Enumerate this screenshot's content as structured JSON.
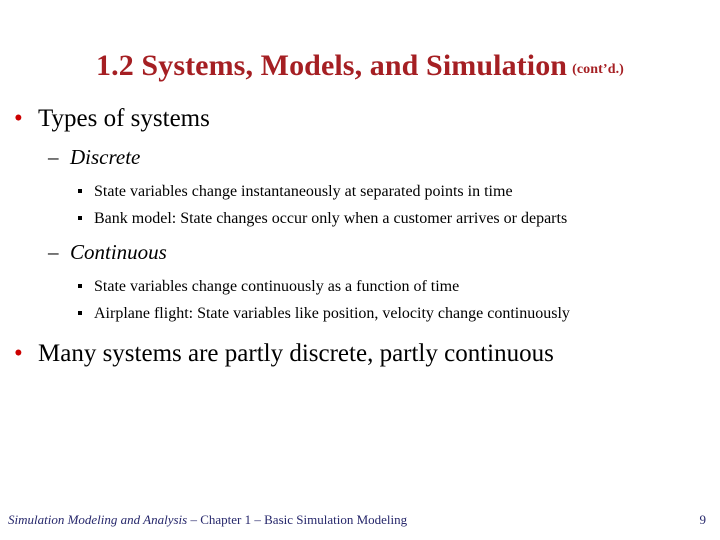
{
  "slide": {
    "title": {
      "main": "1.2  Systems, Models, and Simulation",
      "suffix": "(cont’d.)",
      "color": "#A51F23"
    },
    "bullet_colors": {
      "level1_marker": "#CC0000",
      "level2_marker": "#000000",
      "level3_marker": "#000000",
      "text": "#000000"
    },
    "markers": {
      "level1": "•",
      "level2": "–",
      "level3": "square"
    },
    "content": [
      {
        "level": 1,
        "text": "Types of systems"
      },
      {
        "level": 2,
        "text": "Discrete"
      },
      {
        "level": 3,
        "text": "State variables change instantaneously at separated points in time"
      },
      {
        "level": 3,
        "text": "Bank model:  State changes occur only when a customer arrives or departs"
      },
      {
        "level": 2,
        "text": "Continuous"
      },
      {
        "level": 3,
        "text": "State variables change continuously as a function of time"
      },
      {
        "level": 3,
        "text": "Airplane flight:  State variables like position, velocity change continuously"
      },
      {
        "level": 1,
        "text": "Many systems are partly discrete, partly continuous"
      }
    ],
    "footer": {
      "book_title": "Simulation Modeling and Analysis",
      "rest": " – Chapter 1 –  Basic Simulation Modeling",
      "page_number": "9",
      "color": "#26276B"
    }
  }
}
